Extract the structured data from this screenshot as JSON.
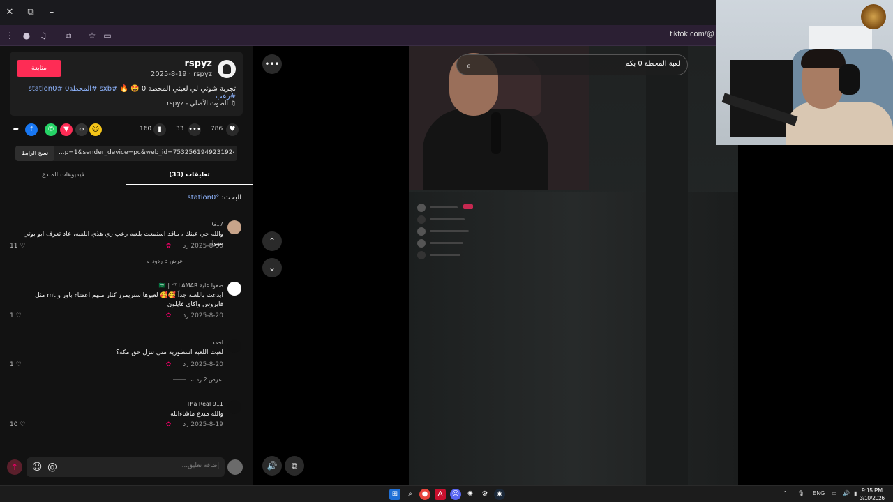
{
  "browser": {
    "url": "tiktok.com/@"
  },
  "post": {
    "follow_label": "متابعة",
    "username": "rspyz",
    "subline": "2025-8-19 · rspyz",
    "caption_text": "تجربة شوتي لي لعبتي المحطة 0 🤩 🔥",
    "caption_tags": "#sxb #المحطة0 #station0 #رعب",
    "sound": "الصوت الأصلي - rspyz",
    "likes": "786",
    "comments_count": "33",
    "saves": "160",
    "link_text": "...p=1&sender_device=pc&web_id=7532561949231924756",
    "copy_link_label": "نسخ الرابط"
  },
  "tabs": {
    "comments": "(33) تعليقات",
    "creator_videos": "فيديوهات المبدع"
  },
  "search": {
    "label": "البحث:",
    "term": "station0"
  },
  "comments": [
    {
      "name": "G17",
      "text": "والله حي عينك ، ماقد استمعت بلعبه رعب زي هذي اللعبه، عاد تعرف ابو بوتي مهول",
      "date": "2025-8-30",
      "reply": "رد",
      "likes": "11",
      "more": "عرض 3 ردود"
    },
    {
      "name": "صفوا علية 🇸🇦 | ᴹᵀ LAMAR",
      "text": "ابدعت باللعبه جداً 🥰🥰 لعبوها ستريمرز كثار منهم اعضاء باور و mt مثل فايروس واكاي فايلون",
      "date": "2025-8-20",
      "reply": "رد",
      "likes": "1",
      "more": ""
    },
    {
      "name": "احمد",
      "text": "لعبت اللعبه اسطوريه متى تنزل حق مكه؟",
      "date": "2025-8-20",
      "reply": "رد",
      "likes": "1",
      "more": "عرض 2 رد"
    },
    {
      "name": "Tha Real 911",
      "text": "والله مبدع ماشاءالله",
      "date": "2025-8-19",
      "reply": "رد",
      "likes": "10",
      "more": ""
    }
  ],
  "composer": {
    "placeholder": "إضافة تعليق..."
  },
  "video": {
    "search_text": "لعبة المحطة 0 بكم"
  },
  "taskbar": {
    "lang": "ENG",
    "time": "9:15 PM",
    "date": "3/10/2026"
  },
  "colors": {
    "accent": "#fe2c55",
    "tag": "#8fb5ff"
  }
}
